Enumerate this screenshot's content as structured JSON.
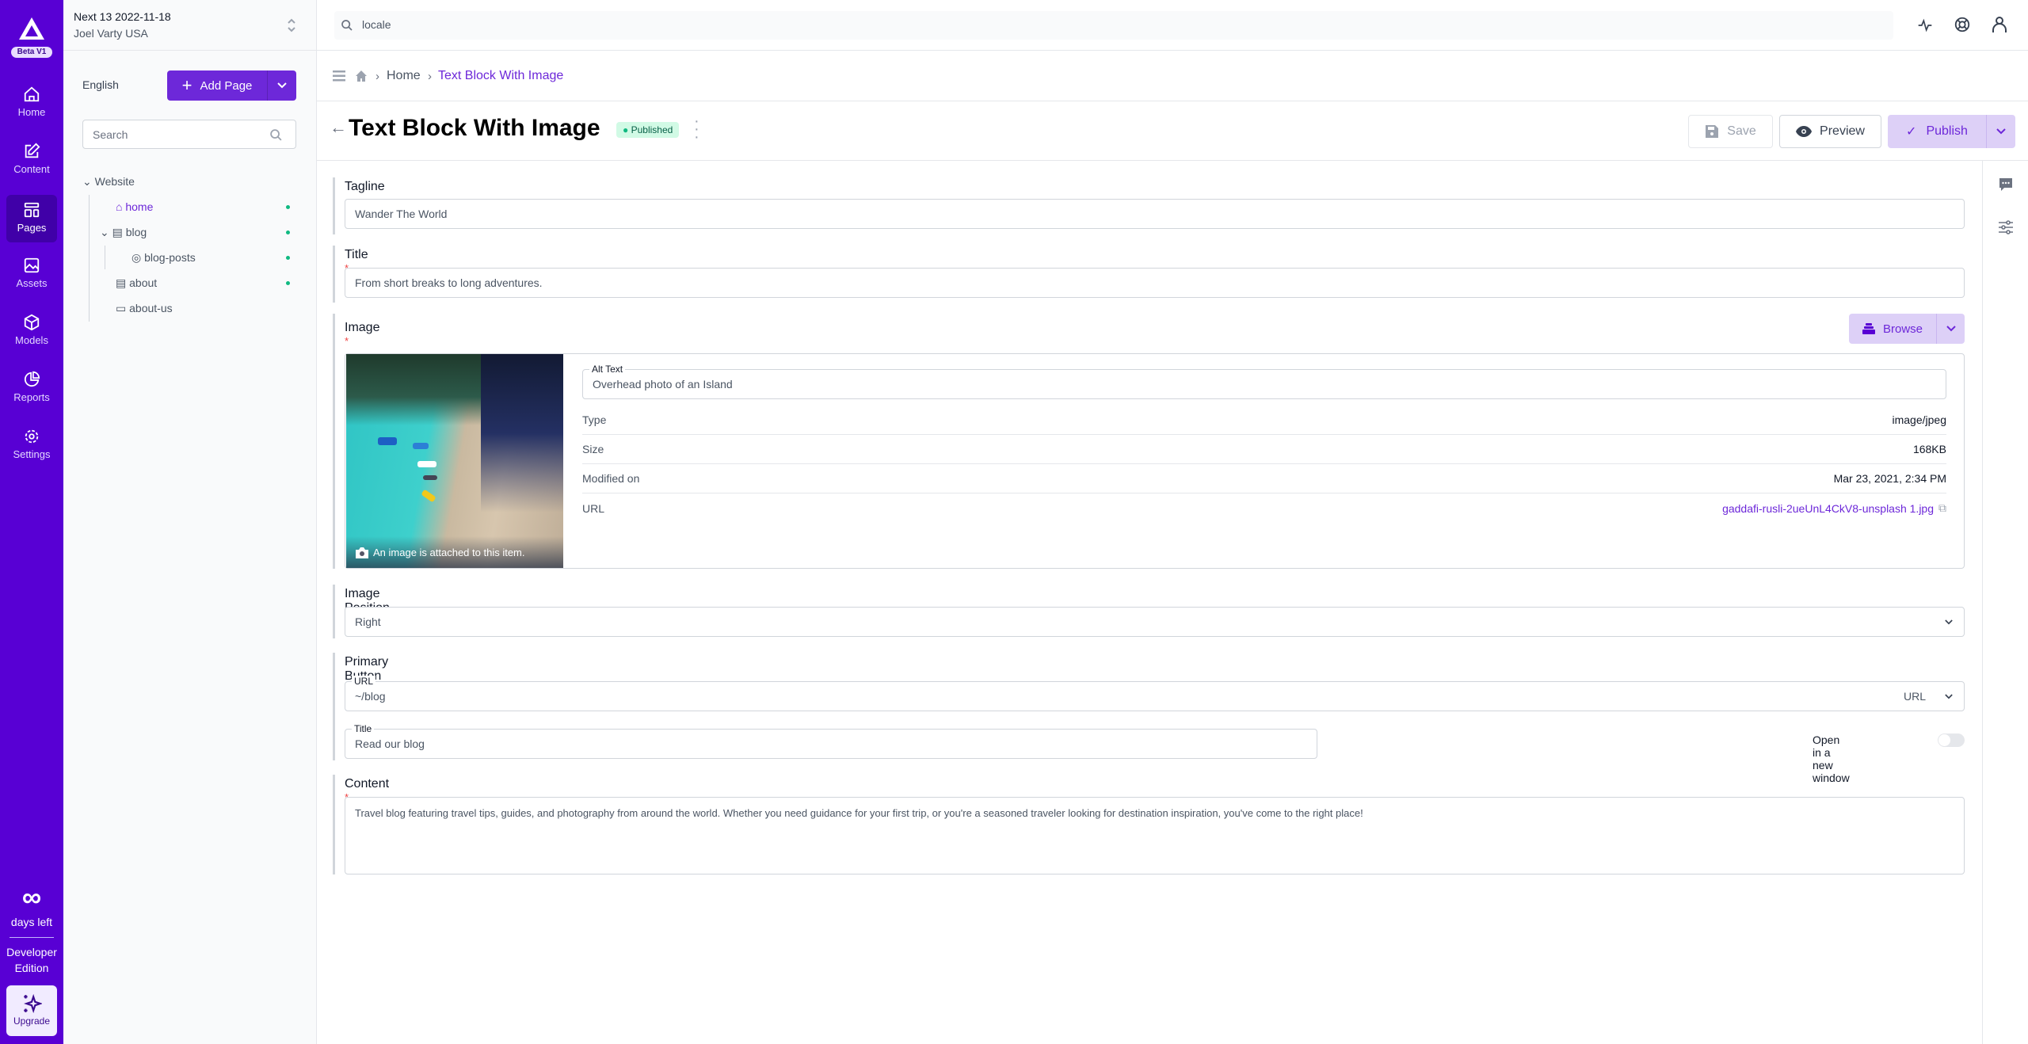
{
  "brand": {
    "badge": "Beta V1"
  },
  "nav": {
    "items": [
      {
        "label": "Home",
        "icon": "home-icon"
      },
      {
        "label": "Content",
        "icon": "edit-icon"
      },
      {
        "label": "Pages",
        "icon": "pages-icon",
        "active": true
      },
      {
        "label": "Assets",
        "icon": "image-icon"
      },
      {
        "label": "Models",
        "icon": "cube-icon"
      },
      {
        "label": "Reports",
        "icon": "pie-chart-icon"
      },
      {
        "label": "Settings",
        "icon": "gear-icon"
      }
    ],
    "trial": {
      "days": "∞",
      "days_label": "days left",
      "edition": "Developer Edition",
      "upgrade": "Upgrade"
    }
  },
  "instance": {
    "name": "Next 13 2022-11-18",
    "org": "Joel Varty USA"
  },
  "tree": {
    "locale": "English",
    "add_page": "Add Page",
    "search_placeholder": "Search",
    "items": [
      {
        "label": "Website"
      },
      {
        "label": "home",
        "status": "published"
      },
      {
        "label": "blog",
        "status": "published"
      },
      {
        "label": "blog-posts",
        "status": "published"
      },
      {
        "label": "about",
        "status": "published"
      },
      {
        "label": "about-us"
      }
    ]
  },
  "topbar": {
    "search_value": "locale"
  },
  "breadcrumb": {
    "items": [
      "Home",
      "Text Block With Image"
    ]
  },
  "page": {
    "title": "Text Block With Image",
    "status": "Published",
    "save": "Save",
    "preview": "Preview",
    "publish": "Publish"
  },
  "form": {
    "tagline": {
      "label": "Tagline",
      "value": "Wander The World"
    },
    "title": {
      "label": "Title",
      "value": "From short breaks to long adventures."
    },
    "image": {
      "label": "Image",
      "browse": "Browse",
      "caption": "An image is attached to this item.",
      "alt_label": "Alt Text",
      "alt_value": "Overhead photo of an Island",
      "rows": [
        {
          "k": "Type",
          "v": "image/jpeg"
        },
        {
          "k": "Size",
          "v": "168KB"
        },
        {
          "k": "Modified on",
          "v": "Mar 23, 2021, 2:34 PM"
        },
        {
          "k": "URL",
          "v": "gaddafi-rusli-2ueUnL4CkV8-unsplash 1.jpg"
        }
      ]
    },
    "image_position": {
      "label": "Image Position",
      "value": "Right"
    },
    "primary_button": {
      "label": "Primary Button",
      "url_label": "URL",
      "url_value": "~/blog",
      "url_type": "URL",
      "title_label": "Title",
      "title_value": "Read our blog",
      "new_window": "Open in a new window",
      "new_window_on": false
    },
    "content": {
      "label": "Content",
      "value": "Travel blog featuring travel tips, guides, and photography from around the world. Whether you need guidance for your first trip, or you're a seasoned traveler looking for destination inspiration, you've come to the right place!"
    }
  },
  "colors": {
    "brand": "#5800d4",
    "accent": "#6d28d9",
    "published": "#10b981"
  }
}
